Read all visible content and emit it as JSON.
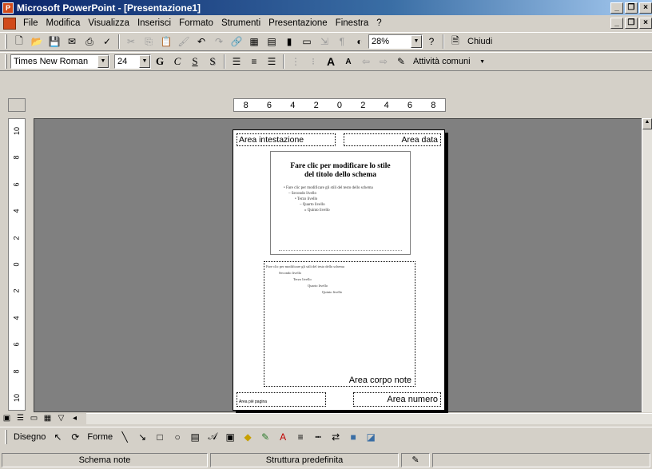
{
  "window": {
    "title": "Microsoft PowerPoint - [Presentazione1]"
  },
  "menu": [
    "File",
    "Modifica",
    "Visualizza",
    "Inserisci",
    "Formato",
    "Strumenti",
    "Presentazione",
    "Finestra",
    "?"
  ],
  "standard_toolbar": {
    "zoom": "28%",
    "close_label": "Chiudi"
  },
  "format_toolbar": {
    "font": "Times New Roman",
    "size": "24",
    "bold": "G",
    "italic": "C",
    "underline": "S",
    "shadow": "S",
    "tasks": "Attività comuni"
  },
  "ruler": {
    "horizontal": [
      "8",
      "6",
      "4",
      "2",
      "0",
      "2",
      "4",
      "6",
      "8"
    ],
    "vertical": [
      "10",
      "8",
      "6",
      "4",
      "2",
      "0",
      "2",
      "4",
      "6",
      "8",
      "10"
    ]
  },
  "notes_page": {
    "header": "Area intestazione",
    "date": "Area data",
    "slide_title": "Fare clic per modificare lo stile del titolo dello schema",
    "slide_bullets": [
      "• Fare clic per modificare gli stili del testo dello schema",
      "– Secondo livello",
      "• Terzo livello",
      "– Quarto livello",
      "» Quinto livello"
    ],
    "body_lines": [
      "Fare clic per modificare gli stili del testo dello schema",
      "Secondo livello",
      "Terzo livello",
      "Quarto livello",
      "Quinto livello"
    ],
    "body_label": "Area corpo note",
    "footer": "Area piè pagina",
    "number": "Area numero"
  },
  "draw_toolbar": {
    "draw": "Disegno",
    "shapes": "Forme"
  },
  "status": {
    "view": "Schema note",
    "design": "Struttura predefinita"
  }
}
